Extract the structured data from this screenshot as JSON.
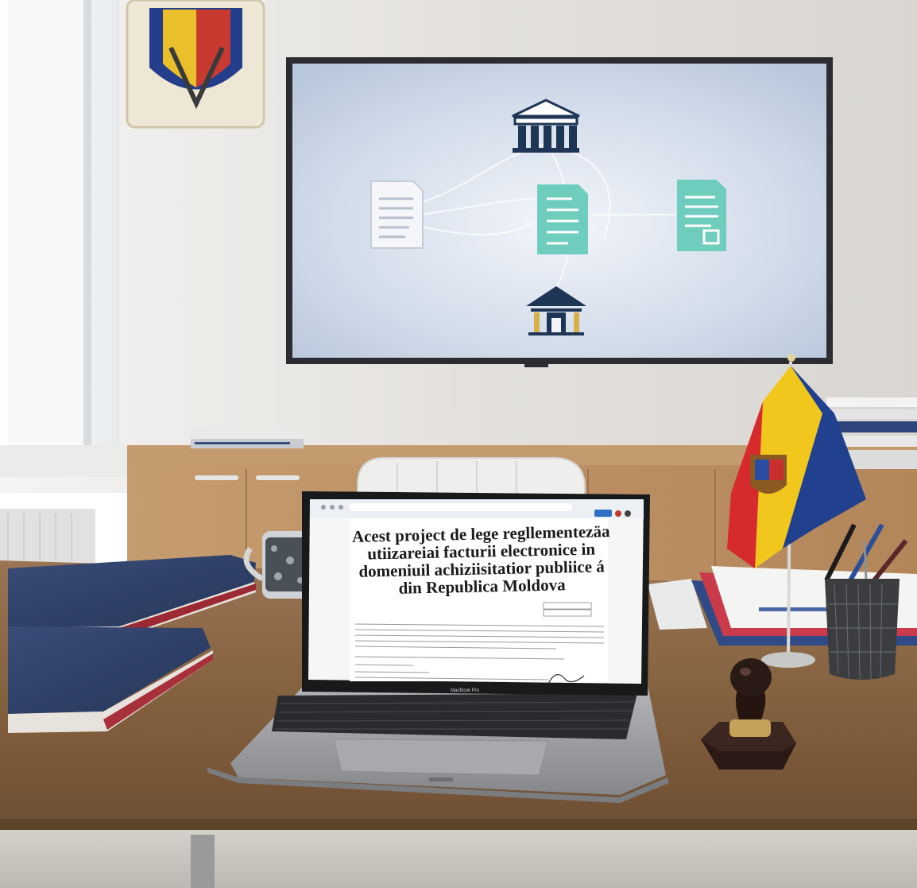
{
  "scene": {
    "description_free": true,
    "colors": {
      "wall": "#e6e3df",
      "tv_screen": "#cbd7e6",
      "desk": "#8f6a49",
      "cabinet": "#b88a5e",
      "laptop_body": "#9a9b9f",
      "screen_paper": "#ffffff",
      "flag_blue": "#1d3f8f",
      "flag_yellow": "#f3c81a",
      "flag_red": "#d3262a",
      "folder_navy": "#2d3f66",
      "teal_doc": "#5fc4b4",
      "stamp": "#2e1b16"
    },
    "icons": {
      "tv_top_building": "government-building-icon",
      "tv_bottom_building": "institution-icon",
      "tv_left_doc": "document-icon",
      "tv_middle_doc": "invoice-icon",
      "tv_right_doc": "document-icon"
    }
  },
  "laptop": {
    "brand": "MacBook Pro",
    "screen": {
      "document_title_lines": [
        "Acest project de lege regllementezäa",
        "utiizareiai facturii electronice in",
        "domeniuil achiziisitatior publiice á",
        "din Republica Moldova"
      ]
    }
  }
}
